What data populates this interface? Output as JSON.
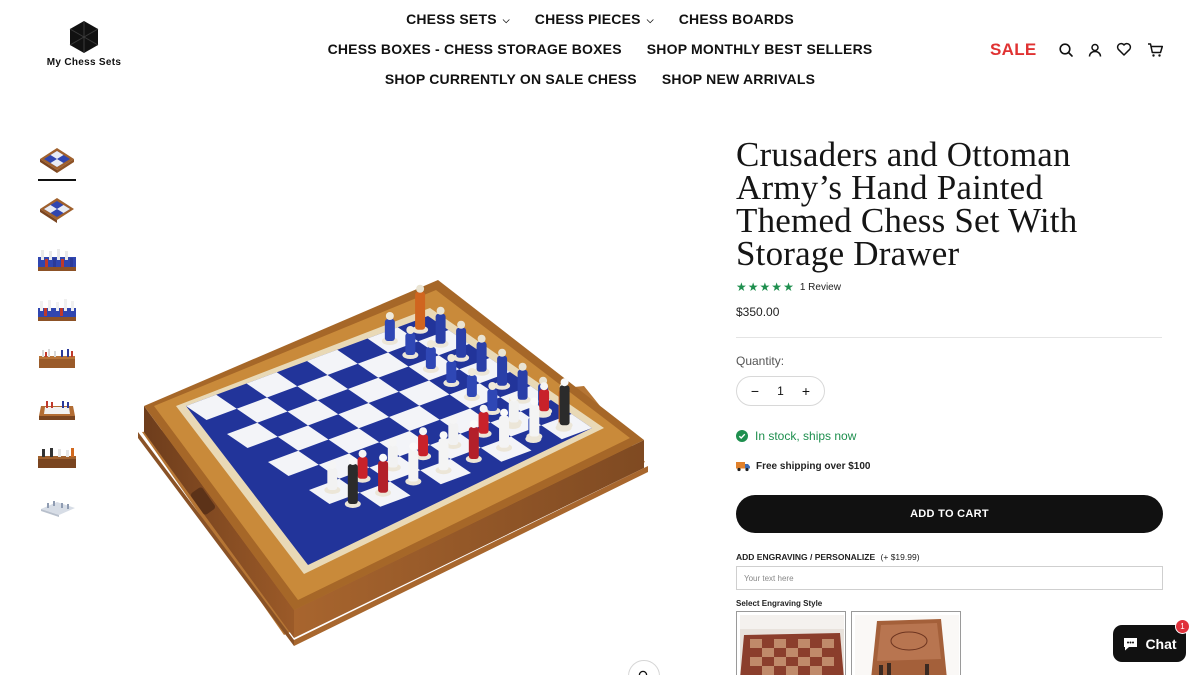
{
  "brand": {
    "name": "My Chess Sets"
  },
  "nav": {
    "row1": [
      {
        "label": "CHESS SETS",
        "has_dropdown": true
      },
      {
        "label": "CHESS PIECES",
        "has_dropdown": true
      },
      {
        "label": "CHESS BOARDS",
        "has_dropdown": false
      }
    ],
    "row2": [
      {
        "label": "CHESS BOXES - CHESS STORAGE BOXES"
      },
      {
        "label": "SHOP MONTHLY BEST SELLERS"
      }
    ],
    "row3": [
      {
        "label": "SHOP CURRENTLY ON SALE CHESS"
      },
      {
        "label": "SHOP NEW ARRIVALS"
      }
    ],
    "sale_label": "SALE",
    "sale_color": "#e03232",
    "icons": [
      "search-icon",
      "account-icon",
      "wishlist-icon",
      "cart-icon"
    ]
  },
  "gallery": {
    "thumbnail_count": 8,
    "active_index": 0
  },
  "product": {
    "title": "Crusaders and Ottoman Army’s Hand Painted Themed Chess Set With Storage Drawer",
    "rating": 5,
    "review_count_label": "1 Review",
    "price": "$350.00",
    "quantity_label": "Quantity:",
    "quantity": "1",
    "stock_status": "In stock, ships now",
    "shipping_note": "Free shipping over $100",
    "add_to_cart_label": "ADD TO CART",
    "engraving": {
      "label": "ADD ENGRAVING / PERSONALIZE",
      "price": "(+ $19.99)",
      "placeholder": "Your text here",
      "value": "",
      "style_label": "Select Engraving Style"
    }
  },
  "chat": {
    "label": "Chat",
    "badge": "1"
  },
  "colors": {
    "accent_green": "#1e8f4e",
    "board_blue": "#24369c",
    "wood": "#a0612d"
  }
}
